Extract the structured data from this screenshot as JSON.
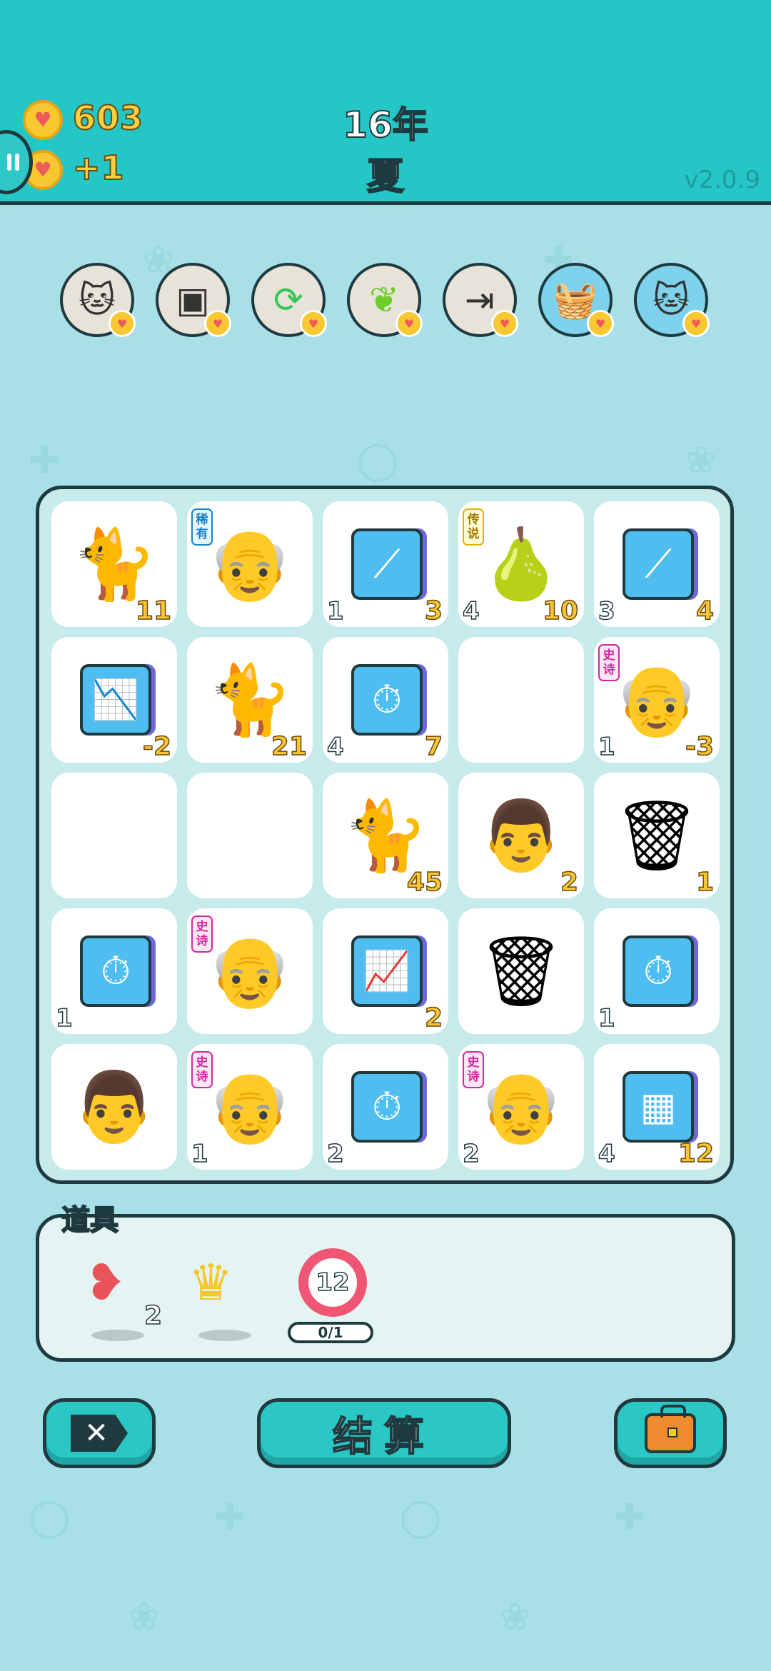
{
  "header": {
    "coins": "603",
    "coins_gain": "+1",
    "year": "16年",
    "season": "夏",
    "version": "v2.0.9"
  },
  "abilities": [
    {
      "icon": "twin-cats-icon"
    },
    {
      "icon": "sugar-cubes-icon"
    },
    {
      "icon": "refresh-arrows-icon"
    },
    {
      "icon": "leaf-icon"
    },
    {
      "icon": "skip-to-end-icon"
    },
    {
      "icon": "fruit-basket-icon"
    },
    {
      "icon": "cat-icon"
    }
  ],
  "board": {
    "rows": [
      [
        {
          "icon": "cat-icon",
          "glyph": "🐈",
          "value": "11"
        },
        {
          "icon": "bald-old-man-icon",
          "glyph": "👴",
          "rarity": "稀有",
          "rarity_color": "blue"
        },
        {
          "icon": "trend-up-icon",
          "glyph": "⟋",
          "box": true,
          "count": "1",
          "value": "3"
        },
        {
          "icon": "pear-icon",
          "glyph": "🍐",
          "rarity": "传说",
          "rarity_color": "gold",
          "count": "4",
          "value": "10"
        },
        {
          "icon": "trend-up-icon",
          "glyph": "⟋",
          "box": true,
          "count": "3",
          "value": "4"
        }
      ],
      [
        {
          "icon": "falling-chart-icon",
          "glyph": "📉",
          "box": true,
          "value": "-2"
        },
        {
          "icon": "cat-icon",
          "glyph": "🐈",
          "value": "21"
        },
        {
          "icon": "stopwatch-icon",
          "glyph": "⏱",
          "box": true,
          "count": "4",
          "value": "7"
        },
        {
          "empty": true
        },
        {
          "icon": "old-man-glasses-icon",
          "glyph": "👴",
          "rarity": "史诗",
          "rarity_color": "pink",
          "count": "1",
          "value": "-3"
        }
      ],
      [
        {
          "empty": true
        },
        {
          "empty": true
        },
        {
          "icon": "cat-icon",
          "glyph": "🐈",
          "value": "45"
        },
        {
          "icon": "bald-man-glasses-icon",
          "glyph": "👨",
          "value": "2"
        },
        {
          "icon": "garbage-bag-icon",
          "glyph": "🗑",
          "value": "1"
        }
      ],
      [
        {
          "icon": "stopwatch-icon",
          "glyph": "⏱",
          "box": true,
          "count": "1"
        },
        {
          "icon": "old-man-glasses-icon",
          "glyph": "👴",
          "rarity": "史诗",
          "rarity_color": "pink"
        },
        {
          "icon": "rising-chart-icon",
          "glyph": "📈",
          "box": true,
          "value": "2"
        },
        {
          "icon": "garbage-bag-icon",
          "glyph": "🗑"
        },
        {
          "icon": "stopwatch-icon",
          "glyph": "⏱",
          "box": true,
          "count": "1"
        }
      ],
      [
        {
          "icon": "bald-man-glasses-icon",
          "glyph": "👨"
        },
        {
          "icon": "old-man-glasses-icon",
          "glyph": "👴",
          "rarity": "史诗",
          "rarity_color": "pink",
          "count": "1"
        },
        {
          "icon": "stopwatch-icon",
          "glyph": "⏱",
          "box": true,
          "count": "2"
        },
        {
          "icon": "old-man-glasses-icon",
          "glyph": "👴",
          "rarity": "史诗",
          "rarity_color": "pink",
          "count": "2"
        },
        {
          "icon": "gold-bars-icon",
          "glyph": "▦",
          "box": true,
          "count": "4",
          "value": "12"
        }
      ]
    ]
  },
  "tools": {
    "title": "道具",
    "items": [
      {
        "icon": "liver-icon",
        "count": "2"
      },
      {
        "icon": "crown-icon",
        "count": ""
      },
      {
        "icon": "timer-icon",
        "number": "12",
        "progress": "0/1"
      }
    ]
  },
  "buttons": {
    "skip": {
      "icon": "skip-x-icon"
    },
    "settle_label": "结算",
    "bag": {
      "icon": "briefcase-icon"
    }
  },
  "colors": {
    "header": "#25c6c6",
    "background": "#a9dfe7",
    "outline": "#1f3a3f",
    "value_yellow": "#f8c535"
  }
}
